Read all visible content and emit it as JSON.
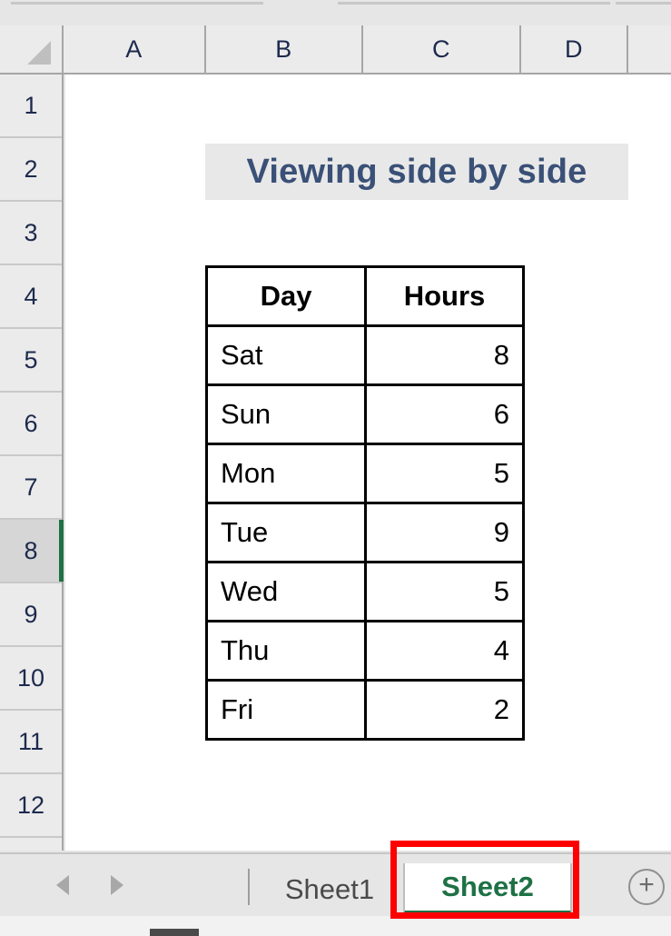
{
  "spreadsheet": {
    "column_headers": [
      "A",
      "B",
      "C",
      "D"
    ],
    "row_headers": [
      "1",
      "2",
      "3",
      "4",
      "5",
      "6",
      "7",
      "8",
      "9",
      "10",
      "11",
      "12"
    ],
    "active_row": "8",
    "select_all_icon": "select-all-triangle-icon"
  },
  "banner": {
    "title": "Viewing side by side"
  },
  "table": {
    "headers": [
      "Day",
      "Hours"
    ],
    "rows": [
      {
        "day": "Sat",
        "hours": "8"
      },
      {
        "day": "Sun",
        "hours": "6"
      },
      {
        "day": "Mon",
        "hours": "5"
      },
      {
        "day": "Tue",
        "hours": "9"
      },
      {
        "day": "Wed",
        "hours": "5"
      },
      {
        "day": "Thu",
        "hours": "4"
      },
      {
        "day": "Fri",
        "hours": "2"
      }
    ]
  },
  "chart_data": {
    "type": "table",
    "title": "Viewing side by side",
    "categories": [
      "Sat",
      "Sun",
      "Mon",
      "Tue",
      "Wed",
      "Thu",
      "Fri"
    ],
    "values": [
      8,
      6,
      5,
      9,
      5,
      4,
      2
    ],
    "xlabel": "Day",
    "ylabel": "Hours"
  },
  "tabbar": {
    "prev_icon": "nav-previous-arrow-icon",
    "next_icon": "nav-next-arrow-icon",
    "tabs": [
      {
        "label": "Sheet1",
        "active": false
      },
      {
        "label": "Sheet2",
        "active": true
      }
    ],
    "add_sheet_label": "+"
  },
  "colors": {
    "accent_green": "#1e7145",
    "title_blue": "#3a5077",
    "annotation_red": "#ff0000",
    "header_gray": "#ebebeb",
    "banner_gray": "#e8e8e8"
  }
}
